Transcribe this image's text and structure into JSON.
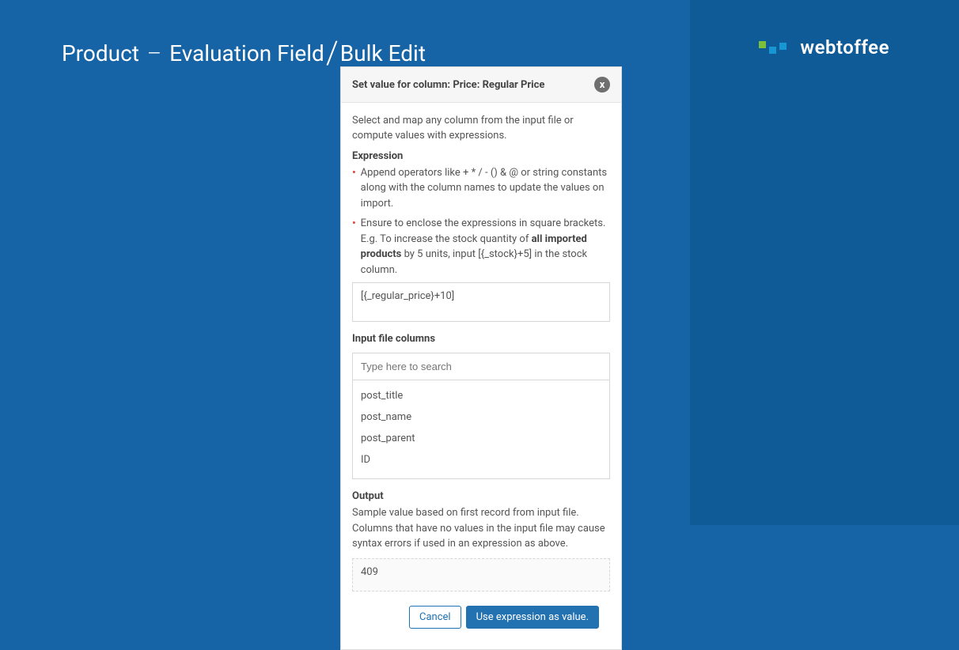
{
  "brand": {
    "name": "webtoffee",
    "colors": {
      "g": "#7cbf3c",
      "b1": "#1896d4",
      "b2": "#1896d4"
    }
  },
  "breadcrumb": {
    "part1": "Product",
    "dash": "–",
    "part2": "Evaluation Field",
    "slash": "/",
    "part3": "Bulk Edit"
  },
  "modal": {
    "title": "Set value for column: Price: Regular Price",
    "close": "x",
    "intro": "Select and map any column from the input file or compute values with expressions.",
    "expression": {
      "label": "Expression",
      "bullet1": "Append operators like + * / - () & @ or string constants along with the column names to update the values on import.",
      "bullet2a": "Ensure to enclose the expressions in square brackets. E.g. To increase the stock quantity of ",
      "bullet2b_bold": "all imported products",
      "bullet2c": " by 5 units, input [{_stock}+5] in the stock column.",
      "value": "[{_regular_price}+10]"
    },
    "input_columns": {
      "label": "Input file columns",
      "search_placeholder": "Type here to search",
      "items": [
        "post_title",
        "post_name",
        "post_parent",
        "ID"
      ]
    },
    "output": {
      "label": "Output",
      "help": "Sample value based on first record from input file. Columns that have no values in the input file may cause syntax errors if used in an expression as above.",
      "value": "409"
    },
    "buttons": {
      "cancel": "Cancel",
      "use": "Use expression as value."
    }
  }
}
